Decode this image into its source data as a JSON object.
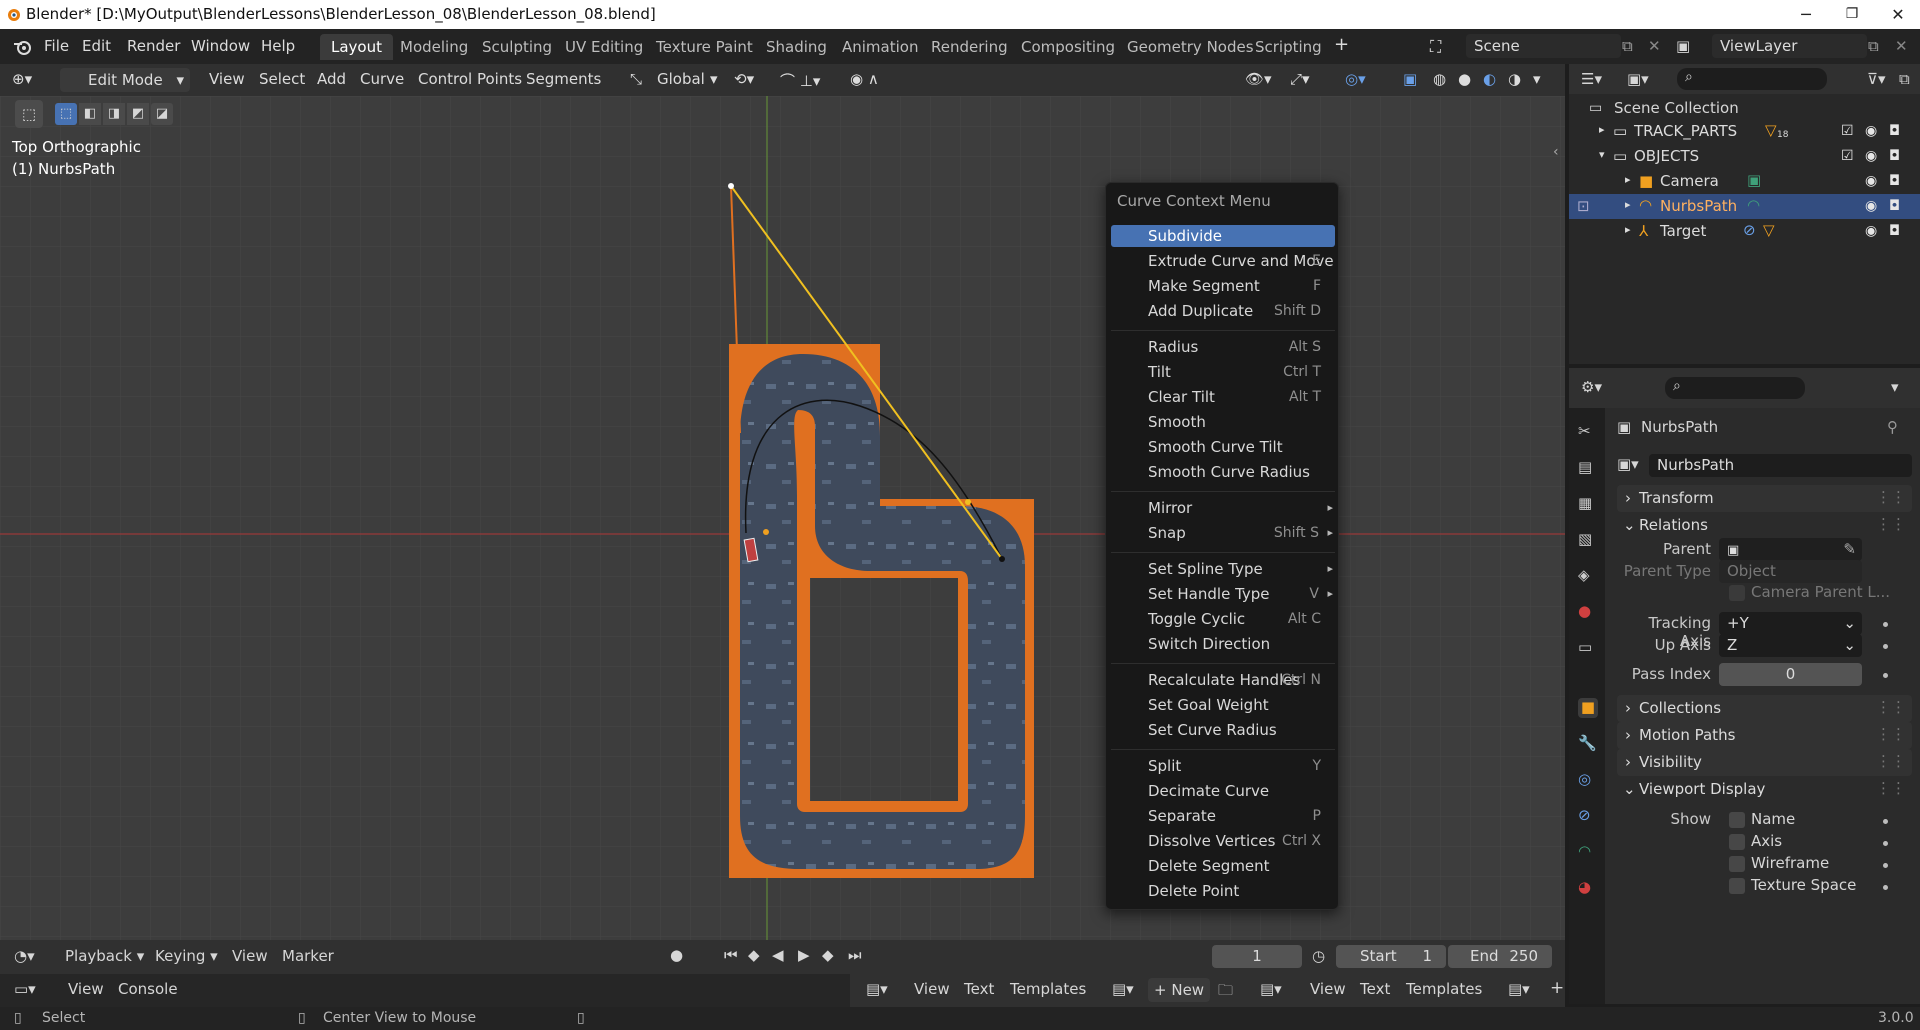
{
  "window": {
    "title": "Blender* [D:\\MyOutput\\BlenderLessons\\BlenderLesson_08\\BlenderLesson_08.blend]",
    "minimize": "─",
    "maximize": "❐",
    "close": "✕"
  },
  "menu": [
    "File",
    "Edit",
    "Render",
    "Window",
    "Help"
  ],
  "workspaces": [
    "Layout",
    "Modeling",
    "Sculpting",
    "UV Editing",
    "Texture Paint",
    "Shading",
    "Animation",
    "Rendering",
    "Compositing",
    "Geometry Nodes",
    "Scripting"
  ],
  "scene": "Scene",
  "view_layer": "ViewLayer",
  "viewport_header": {
    "mode": "Edit Mode",
    "items": [
      "View",
      "Select",
      "Add",
      "Curve",
      "Control Points",
      "Segments"
    ],
    "orientation": "Global"
  },
  "viewport": {
    "view_name": "Top Orthographic",
    "object_name": "(1) NurbsPath"
  },
  "context_menu": {
    "title": "Curve Context Menu",
    "items": [
      {
        "label": "Subdivide",
        "shortcut": ""
      },
      {
        "label": "Extrude Curve and Move",
        "shortcut": "E"
      },
      {
        "label": "Make Segment",
        "shortcut": "F"
      },
      {
        "label": "Add Duplicate",
        "shortcut": "Shift D"
      },
      {
        "label": "Radius",
        "shortcut": "Alt S"
      },
      {
        "label": "Tilt",
        "shortcut": "Ctrl T"
      },
      {
        "label": "Clear Tilt",
        "shortcut": "Alt T"
      },
      {
        "label": "Smooth",
        "shortcut": ""
      },
      {
        "label": "Smooth Curve Tilt",
        "shortcut": ""
      },
      {
        "label": "Smooth Curve Radius",
        "shortcut": ""
      },
      {
        "label": "Mirror",
        "shortcut": ""
      },
      {
        "label": "Snap",
        "shortcut": "Shift S"
      },
      {
        "label": "Set Spline Type",
        "shortcut": ""
      },
      {
        "label": "Set Handle Type",
        "shortcut": "V"
      },
      {
        "label": "Toggle Cyclic",
        "shortcut": "Alt C"
      },
      {
        "label": "Switch Direction",
        "shortcut": ""
      },
      {
        "label": "Recalculate Handles",
        "shortcut": "Ctrl N"
      },
      {
        "label": "Set Goal Weight",
        "shortcut": ""
      },
      {
        "label": "Set Curve Radius",
        "shortcut": ""
      },
      {
        "label": "Split",
        "shortcut": "Y"
      },
      {
        "label": "Decimate Curve",
        "shortcut": ""
      },
      {
        "label": "Separate",
        "shortcut": "P"
      },
      {
        "label": "Dissolve Vertices",
        "shortcut": "Ctrl X"
      },
      {
        "label": "Delete Segment",
        "shortcut": ""
      },
      {
        "label": "Delete Point",
        "shortcut": ""
      }
    ]
  },
  "outliner": {
    "root": "Scene Collection",
    "rows": [
      {
        "label": "TRACK_PARTS",
        "badge": "18"
      },
      {
        "label": "OBJECTS"
      },
      {
        "label": "Camera"
      },
      {
        "label": "NurbsPath"
      },
      {
        "label": "Target"
      }
    ]
  },
  "properties": {
    "object_name": "NurbsPath",
    "data_name": "NurbsPath",
    "panels": {
      "transform": "Transform",
      "relations": "Relations",
      "collections": "Collections",
      "motion_paths": "Motion Paths",
      "visibility": "Visibility",
      "viewport_display": "Viewport Display"
    },
    "parent_label": "Parent",
    "parent_type_label": "Parent Type",
    "parent_type_value": "Object",
    "camera_parent_lock": "Camera Parent L...",
    "tracking_axis_label": "Tracking Axis",
    "tracking_axis_value": "+Y",
    "up_axis_label": "Up Axis",
    "up_axis_value": "Z",
    "pass_index_label": "Pass Index",
    "pass_index_value": "0",
    "show_label": "Show",
    "show_options": [
      "Name",
      "Axis",
      "Wireframe",
      "Texture Space"
    ]
  },
  "timeline": {
    "items": [
      "Playback",
      "Keying",
      "View",
      "Marker"
    ],
    "current_frame": "1",
    "start_label": "Start",
    "start_value": "1",
    "end_label": "End",
    "end_value": "250"
  },
  "console_bar": {
    "left_items": [
      "View",
      "Console"
    ],
    "mid_items": [
      "View",
      "Text",
      "Templates"
    ],
    "new_label": "New",
    "right_items": [
      "View",
      "Text",
      "Templates"
    ]
  },
  "status": {
    "select": "Select",
    "center_view": "Center View to Mouse",
    "version": "3.0.0"
  },
  "colors": {
    "accent": "#4772b3",
    "selected_row": "#334d80",
    "track_orange": "#e07020",
    "handle_yellow": "#f0c020"
  }
}
